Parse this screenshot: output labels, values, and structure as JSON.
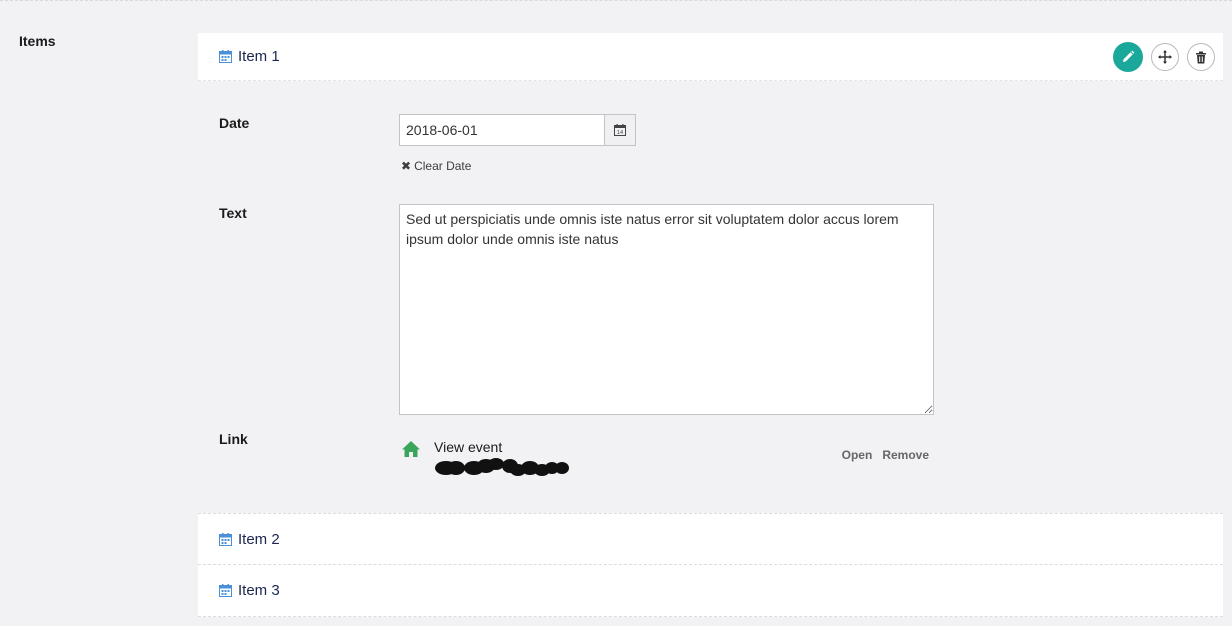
{
  "section": {
    "label": "Items"
  },
  "items": [
    {
      "title": "Item 1"
    },
    {
      "title": "Item 2"
    },
    {
      "title": "Item 3"
    }
  ],
  "fields": {
    "date": {
      "label": "Date",
      "value": "2018-06-01",
      "clear_label": "Clear Date"
    },
    "text": {
      "label": "Text",
      "value": "Sed ut perspiciatis unde omnis iste natus error sit voluptatem dolor accus lorem ipsum dolor unde omnis iste natus"
    },
    "link": {
      "label": "Link",
      "title": "View event",
      "open_label": "Open",
      "remove_label": "Remove"
    }
  },
  "colors": {
    "accent": "#1aa89b",
    "calendar_icon": "#4a90d9",
    "home_icon": "#3ba55c",
    "background": "#f2f2f4"
  },
  "icons": {
    "item": "calendar-icon",
    "edit": "pencil-icon",
    "move": "move-icon",
    "delete": "trash-icon",
    "date_picker": "calendar-icon",
    "clear": "close-icon",
    "link": "home-icon"
  }
}
